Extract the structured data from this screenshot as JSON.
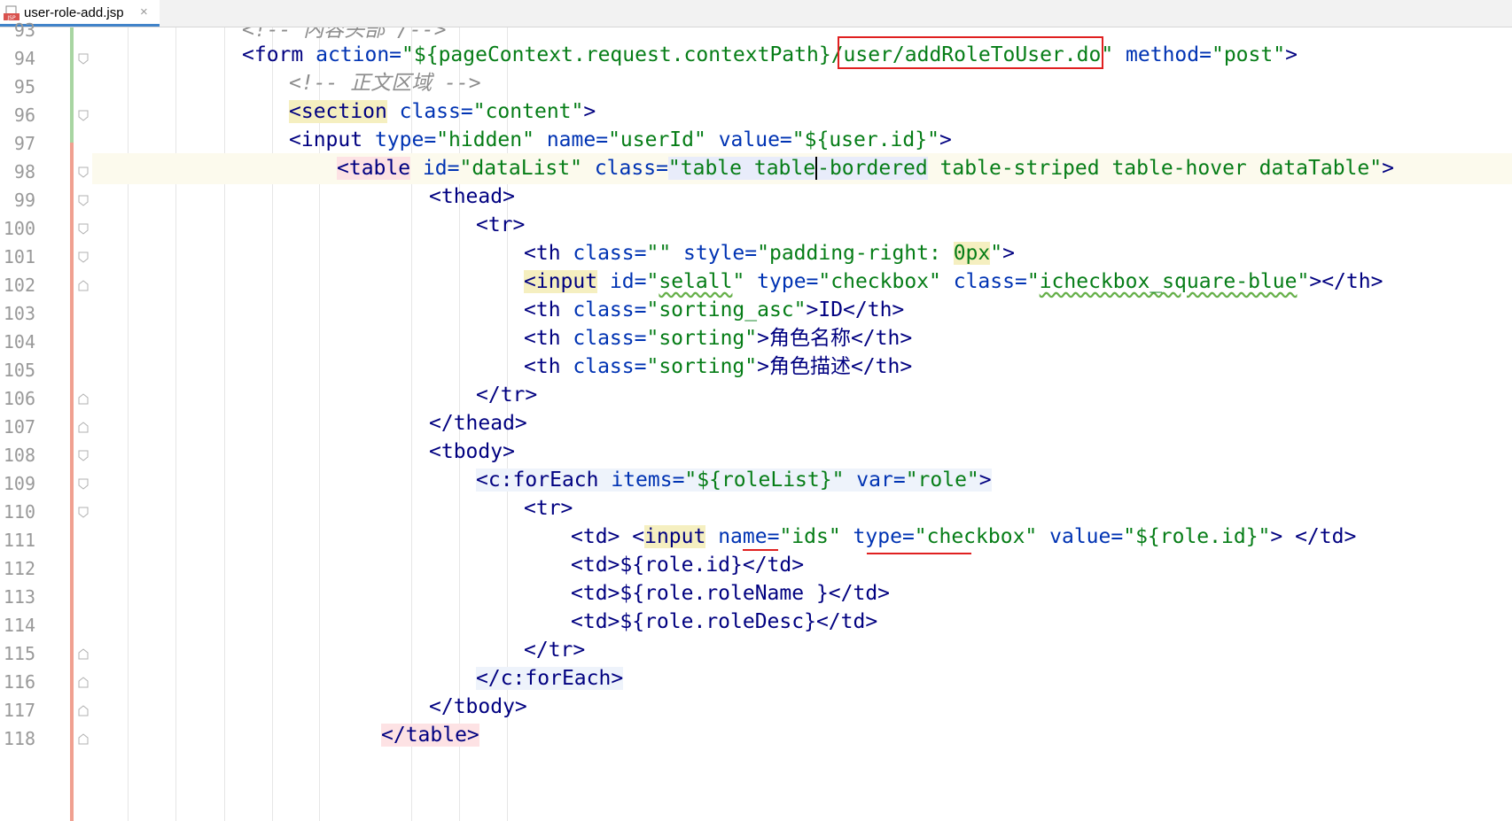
{
  "tab": {
    "filename": "user-role-add.jsp",
    "icon": "jsp-file-icon",
    "close_glyph": "×"
  },
  "lines": [
    {
      "number": "93",
      "indent": 0,
      "tokens": []
    },
    {
      "number": "94",
      "indent": 0,
      "tokens": []
    },
    {
      "number": "95",
      "indent": 0,
      "tokens": []
    },
    {
      "number": "96",
      "indent": 0,
      "tokens": []
    },
    {
      "number": "97",
      "indent": 0,
      "tokens": []
    },
    {
      "number": "98",
      "indent": 0,
      "tokens": []
    },
    {
      "number": "99",
      "indent": 0,
      "tokens": []
    },
    {
      "number": "100",
      "indent": 0,
      "tokens": []
    },
    {
      "number": "101",
      "indent": 0,
      "tokens": []
    },
    {
      "number": "102",
      "indent": 0,
      "tokens": []
    },
    {
      "number": "103",
      "indent": 0,
      "tokens": []
    },
    {
      "number": "104",
      "indent": 0,
      "tokens": []
    },
    {
      "number": "105",
      "indent": 0,
      "tokens": []
    },
    {
      "number": "106",
      "indent": 0,
      "tokens": []
    },
    {
      "number": "107",
      "indent": 0,
      "tokens": []
    },
    {
      "number": "108",
      "indent": 0,
      "tokens": []
    },
    {
      "number": "109",
      "indent": 0,
      "tokens": []
    },
    {
      "number": "110",
      "indent": 0,
      "tokens": []
    },
    {
      "number": "111",
      "indent": 0,
      "tokens": []
    },
    {
      "number": "112",
      "indent": 0,
      "tokens": []
    },
    {
      "number": "113",
      "indent": 0,
      "tokens": []
    },
    {
      "number": "114",
      "indent": 0,
      "tokens": []
    },
    {
      "number": "115",
      "indent": 0,
      "tokens": []
    },
    {
      "number": "116",
      "indent": 0,
      "tokens": []
    },
    {
      "number": "117",
      "indent": 0,
      "tokens": []
    },
    {
      "number": "118",
      "indent": 0,
      "tokens": []
    }
  ],
  "code": {
    "l93": "<!-- 内容头部 /-->",
    "l94a": "<form",
    "l94b": " action=",
    "l94c": "\"${pageContext.request.contextPath}",
    "l94d": "/user/addRoleToUser.do\"",
    "l94e": " method=",
    "l94f": "\"post\"",
    "l94g": ">",
    "l95": "<!-- 正文区域 -->",
    "l96a": "<",
    "l96b": "section",
    "l96c": " class=",
    "l96d": "\"content\"",
    "l96e": ">",
    "l97a": "<input",
    "l97b": " type=",
    "l97c": "\"hidden\"",
    "l97d": " name=",
    "l97e": "\"userId\"",
    "l97f": " value=",
    "l97g": "\"${user.id}\"",
    "l97h": ">",
    "l98a": "<",
    "l98b": "table",
    "l98c": " id=",
    "l98d": "\"dataList\"",
    "l98e": " class=",
    "l98f": "\"table ",
    "l98g": "table",
    "l98h": "-bordered",
    "l98i": " table-striped table-hover dataTable\"",
    "l98j": ">",
    "l99": "<thead>",
    "l100": "<tr>",
    "l101a": "<th",
    "l101b": " class=",
    "l101c": "\"\"",
    "l101d": " style=",
    "l101e": "\"padding-right: ",
    "l101f": "0px",
    "l101g": "\"",
    "l101h": ">",
    "l102a": "<",
    "l102b": "input",
    "l102c": " id=",
    "l102d": "\"",
    "l102e": "selall",
    "l102f": "\"",
    "l102g": " type=",
    "l102h": "\"checkbox\"",
    "l102i": " class=",
    "l102j": "\"",
    "l102k": "icheckbox_square-blue",
    "l102l": "\"",
    "l102m": "></th>",
    "l103a": "<th",
    "l103b": " class=",
    "l103c": "\"sorting_asc\"",
    "l103d": ">ID</th>",
    "l104a": "<th",
    "l104b": " class=",
    "l104c": "\"sorting\"",
    "l104d": ">角色名称</th>",
    "l105a": "<th",
    "l105b": " class=",
    "l105c": "\"sorting\"",
    "l105d": ">角色描述</th>",
    "l106": "</tr>",
    "l107": "</thead>",
    "l108": "<tbody>",
    "l109a": "<",
    "l109b": "c:forEach",
    "l109c": " items=",
    "l109d": "\"${roleList}\"",
    "l109e": " var=",
    "l109f": "\"role\"",
    "l109g": ">",
    "l110": "<tr>",
    "l111a": "<td> <",
    "l111b": "input",
    "l111c": " name=",
    "l111d": "\"",
    "l111e": "ids",
    "l111f": "\"",
    "l111g": " type=",
    "l111h": "\"checkbox\"",
    "l111i": " value=",
    "l111j": "\"${role.id}\"",
    "l111k": "> </td>",
    "l112": "<td>${role.id}</td>",
    "l113": "<td>${role.roleName }</td>",
    "l114": "<td>${role.roleDesc}</td>",
    "l115": "</tr>",
    "l116a": "</",
    "l116b": "c:forEach",
    "l116c": ">",
    "l117": "</tbody>",
    "l118": "</table>"
  },
  "colors": {
    "annotation": "#e02020",
    "vcs_added": "#a8d5a2",
    "vcs_modified": "#f0a090",
    "tag": "#000080",
    "attr": "#0033b3",
    "string": "#067d17",
    "comment": "#8c8c8c"
  }
}
